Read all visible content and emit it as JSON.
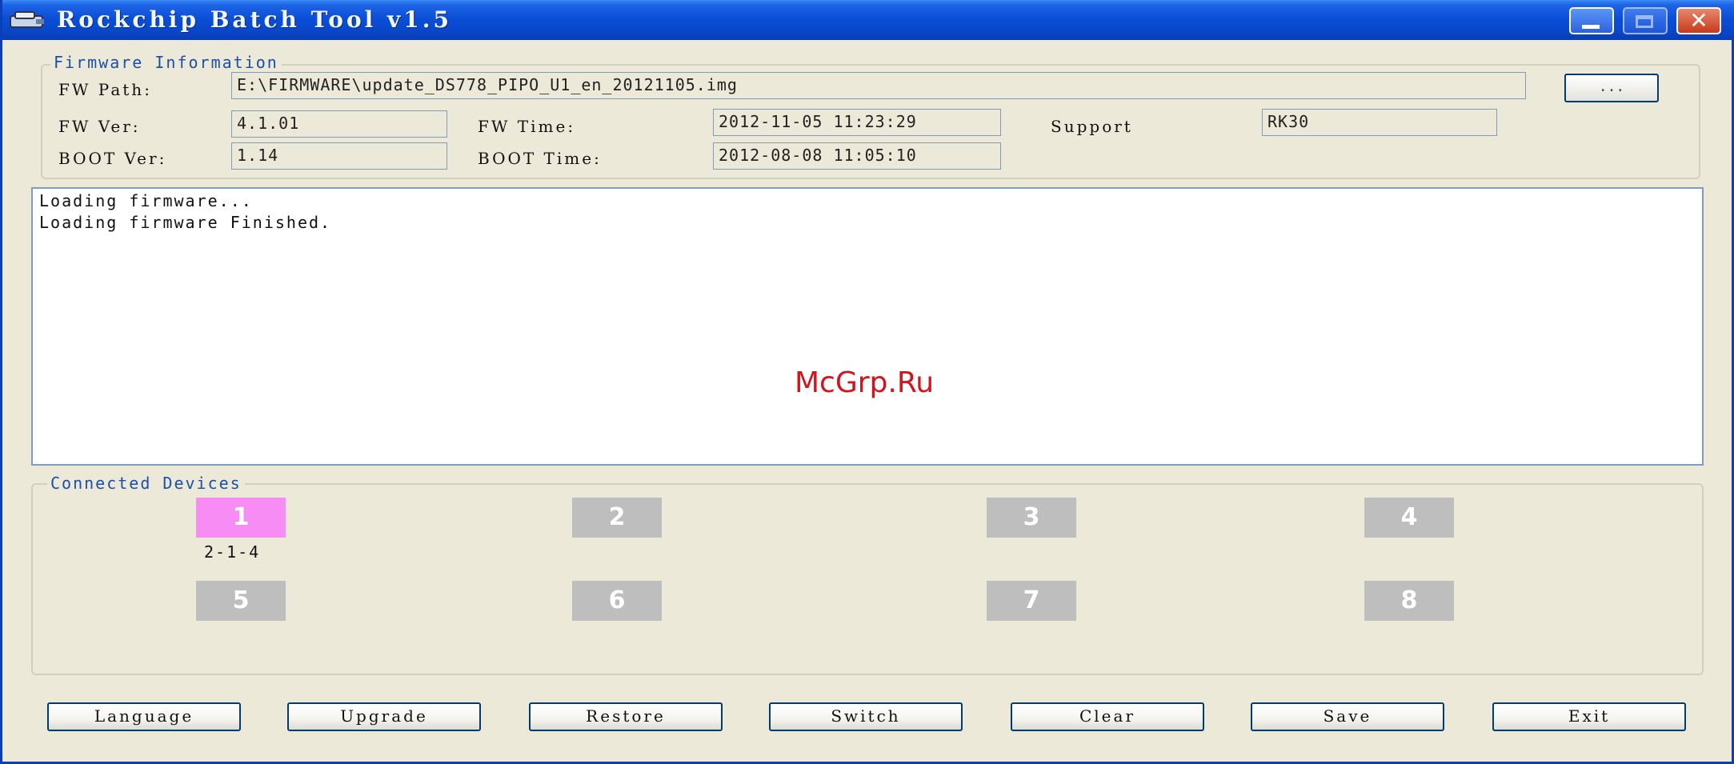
{
  "window": {
    "title": "Rockchip Batch Tool v1.5",
    "title_color": "#0a4fd8"
  },
  "firmware": {
    "legend": "Firmware Information",
    "fw_path_label": "FW Path:",
    "fw_path_value": "E:\\FIRMWARE\\update_DS778_PIPO_U1_en_20121105.img",
    "browse_label": "...",
    "fw_ver_label": "FW Ver:",
    "fw_ver_value": "4.1.01",
    "fw_time_label": "FW Time:",
    "fw_time_value": "2012-11-05 11:23:29",
    "support_label": "Support",
    "support_value": "RK30",
    "boot_ver_label": "BOOT Ver:",
    "boot_ver_value": "1.14",
    "boot_time_label": "BOOT Time:",
    "boot_time_value": "2012-08-08 11:05:10"
  },
  "log": {
    "lines": [
      "Loading firmware...",
      "Loading firmware Finished."
    ]
  },
  "watermark": "McGrp.Ru",
  "devices": {
    "legend": "Connected Devices",
    "items": [
      {
        "label": "1",
        "active": true,
        "port": "2-1-4"
      },
      {
        "label": "2",
        "active": false
      },
      {
        "label": "3",
        "active": false
      },
      {
        "label": "4",
        "active": false
      },
      {
        "label": "5",
        "active": false
      },
      {
        "label": "6",
        "active": false
      },
      {
        "label": "7",
        "active": false
      },
      {
        "label": "8",
        "active": false
      }
    ],
    "active_color": "#f78cf5",
    "inactive_color": "#bebebe"
  },
  "buttons": {
    "language": "Language",
    "upgrade": "Upgrade",
    "restore": "Restore",
    "switch": "Switch",
    "clear": "Clear",
    "save": "Save",
    "exit": "Exit"
  }
}
